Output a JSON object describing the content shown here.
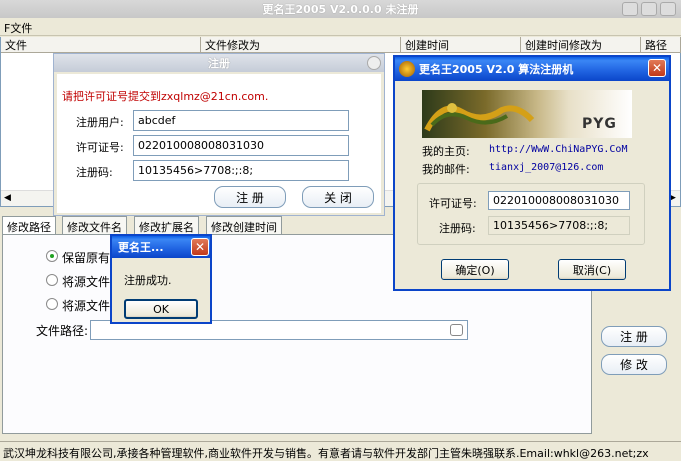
{
  "main_window": {
    "title": "更名王2005 V2.0.0.0 未注册",
    "menu_file": "F文件",
    "columns": [
      "文件",
      "文件修改为",
      "创建时间",
      "创建时间修改为",
      "路径"
    ],
    "tabs": [
      "修改路径",
      "修改文件名",
      "修改扩展名",
      "修改创建时间"
    ],
    "options": [
      "保留原有",
      "将源文件",
      "将源文件"
    ],
    "path_label": "文件路径:",
    "register_button": "注 册",
    "modify_button": "修 改",
    "status_bar": "武汉坤龙科技有限公司,承接各种管理软件,商业软件开发与销售。有意者请与软件开发部门主管朱晓强联系.Email:whkl@263.net;zx"
  },
  "register_dialog": {
    "title": "注册",
    "notice": "请把许可证号提交到zxqlmz@21cn.com.",
    "user_label": "注册用户:",
    "user_value": "abcdef",
    "license_label": "许可证号:",
    "license_value": "022010008008031030",
    "code_label": "注册码:",
    "code_value": "10135456>7708:;:8;",
    "register_button": "注 册",
    "close_button": "关 闭"
  },
  "keygen": {
    "title": "更名王2005  V2.0  算法注册机",
    "homepage_label": "我的主页:",
    "homepage_value": "http://WwW.ChiNaPYG.CoM",
    "email_label": "我的邮件:",
    "email_value": "tianxj_2007@126.com",
    "license_label": "许可证号:",
    "license_value": "022010008008031030",
    "code_label": "注册码:",
    "code_value": "10135456>7708:;:8;",
    "ok_button": "确定(O)",
    "cancel_button": "取消(C)",
    "banner_text": "PYG"
  },
  "message_box": {
    "title": "更名王...",
    "message": "注册成功.",
    "ok_button": "OK"
  }
}
